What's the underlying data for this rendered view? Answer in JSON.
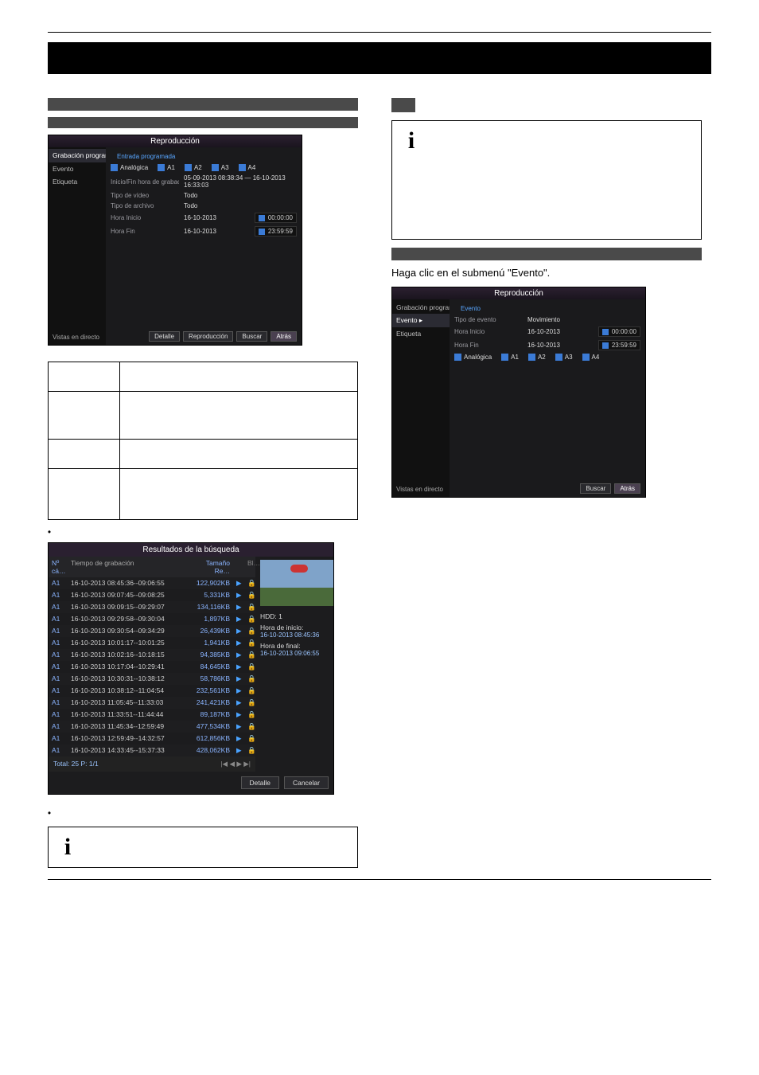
{
  "step_text": "Haga clic en el submenú \"Evento\".",
  "note_icon": "i",
  "playback1": {
    "title": "Reproducción",
    "sidebar": [
      "Grabación programada  ▸",
      "Evento",
      "Etiqueta"
    ],
    "link": "Entrada programada",
    "camera_label": "Analógica",
    "cams": [
      "A1",
      "A2",
      "A3",
      "A4"
    ],
    "rows": [
      {
        "label": "Inicio/Fin hora de grabación",
        "value": "05-09-2013 08:38:34 — 16-10-2013 16:33:03"
      },
      {
        "label": "Tipo de vídeo",
        "value": "Todo"
      },
      {
        "label": "Tipo de archivo",
        "value": "Todo"
      },
      {
        "label": "Hora Inicio",
        "value": "16-10-2013",
        "time": "00:00:00"
      },
      {
        "label": "Hora Fin",
        "value": "16-10-2013",
        "time": "23:59:59"
      }
    ],
    "buttons": [
      "Detalle",
      "Reproducción",
      "Buscar",
      "Atrás"
    ],
    "footer": "Vistas en directo"
  },
  "playback2": {
    "title": "Reproducción",
    "sidebar": [
      "Grabación programada",
      "Evento  ▸",
      "Etiqueta"
    ],
    "link": "Evento",
    "rows": [
      {
        "label": "Tipo de evento",
        "value": "Movimiento"
      },
      {
        "label": "Hora Inicio",
        "value": "16-10-2013",
        "time": "00:00:00"
      },
      {
        "label": "Hora Fin",
        "value": "16-10-2013",
        "time": "23:59:59"
      }
    ],
    "camera_label": "Analógica",
    "cams": [
      "A1",
      "A2",
      "A3",
      "A4"
    ],
    "buttons": [
      "Buscar",
      "Atrás"
    ],
    "footer": "Vistas en directo"
  },
  "results": {
    "title": "Resultados de la búsqueda",
    "headers": [
      "Nº cá…",
      "Tiempo de grabación",
      "Tamaño Re…",
      "Bl…"
    ],
    "rows": [
      {
        "ch": "A1",
        "t": "16-10-2013 08:45:36--09:06:55",
        "s": "122,902KB"
      },
      {
        "ch": "A1",
        "t": "16-10-2013 09:07:45--09:08:25",
        "s": "5,331KB"
      },
      {
        "ch": "A1",
        "t": "16-10-2013 09:09:15--09:29:07",
        "s": "134,116KB"
      },
      {
        "ch": "A1",
        "t": "16-10-2013 09:29:58--09:30:04",
        "s": "1,897KB"
      },
      {
        "ch": "A1",
        "t": "16-10-2013 09:30:54--09:34:29",
        "s": "26,439KB"
      },
      {
        "ch": "A1",
        "t": "16-10-2013 10:01:17--10:01:25",
        "s": "1,941KB"
      },
      {
        "ch": "A1",
        "t": "16-10-2013 10:02:16--10:18:15",
        "s": "94,385KB"
      },
      {
        "ch": "A1",
        "t": "16-10-2013 10:17:04--10:29:41",
        "s": "84,645KB"
      },
      {
        "ch": "A1",
        "t": "16-10-2013 10:30:31--10:38:12",
        "s": "58,786KB"
      },
      {
        "ch": "A1",
        "t": "16-10-2013 10:38:12--11:04:54",
        "s": "232,561KB"
      },
      {
        "ch": "A1",
        "t": "16-10-2013 11:05:45--11:33:03",
        "s": "241,421KB"
      },
      {
        "ch": "A1",
        "t": "16-10-2013 11:33:51--11:44:44",
        "s": "89,187KB"
      },
      {
        "ch": "A1",
        "t": "16-10-2013 11:45:34--12:59:49",
        "s": "477,534KB"
      },
      {
        "ch": "A1",
        "t": "16-10-2013 12:59:49--14:32:57",
        "s": "612,856KB"
      },
      {
        "ch": "A1",
        "t": "16-10-2013 14:33:45--15:37:33",
        "s": "428,062KB"
      }
    ],
    "footer_total": "Total: 25 P: 1/1",
    "side": {
      "hdd_label": "HDD: 1",
      "start_label": "Hora de inicio:",
      "start_value": "16-10-2013 08:45:36",
      "end_label": "Hora de final:",
      "end_value": "16-10-2013 09:06:55"
    },
    "buttons": [
      "Detalle",
      "Cancelar"
    ]
  },
  "page_number": ""
}
